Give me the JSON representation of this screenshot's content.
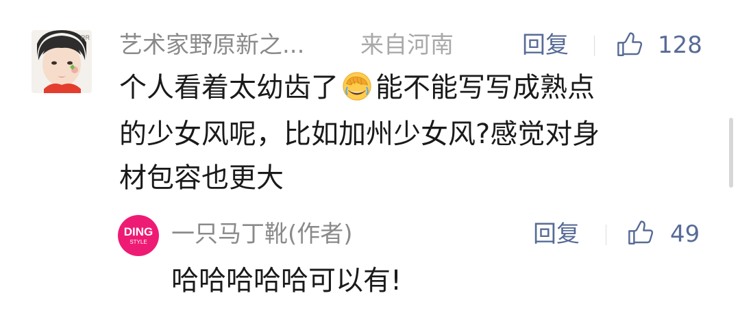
{
  "comment": {
    "username": "艺术家野原新之...",
    "location": "来自河南",
    "reply_label": "回复",
    "like_count": "128",
    "lines": [
      {
        "before": "个人看着太幼齿了",
        "emoji": "facepalm-laughing-emoji",
        "after": "能不能写写成熟点"
      },
      {
        "text": "的少女风呢，比如加州少女风?感觉对身"
      },
      {
        "text": "材包容也更大"
      }
    ]
  },
  "reply": {
    "avatar_brand": "DING",
    "avatar_sub": "STYLE",
    "author": "一只马丁靴(作者)",
    "reply_label": "回复",
    "like_count": "49",
    "text": "哈哈哈哈哈可以有!"
  },
  "colors": {
    "link_blue": "#576b95",
    "username_gray": "#8a8a8a",
    "location_gray": "#a9a9a9",
    "text_dark": "#1a1a1a",
    "brand_pink": "#ee1b74"
  },
  "icons": [
    "thumbs-up-icon",
    "facepalm-laughing-emoji"
  ]
}
